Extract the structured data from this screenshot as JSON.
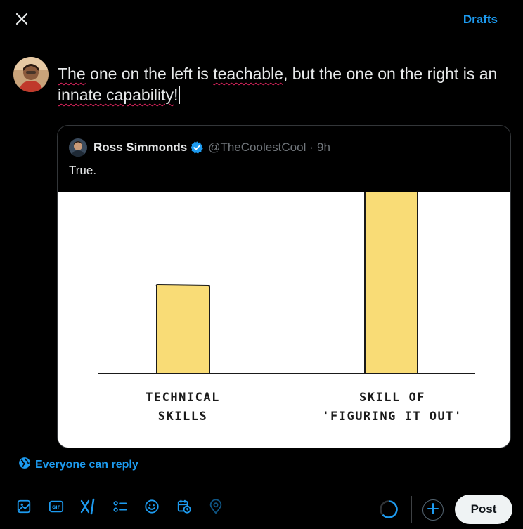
{
  "header": {
    "close_icon": "close-icon",
    "drafts_label": "Drafts"
  },
  "composer": {
    "text_parts": [
      "The",
      " one on the left is ",
      "teachable",
      ", but the one on the right is an ",
      "innate capability",
      "!"
    ]
  },
  "quote": {
    "author_name": "Ross Simmonds",
    "verified": true,
    "handle": "@TheCoolestCool",
    "separator": "·",
    "time": "9h",
    "text": "True.",
    "image": {
      "bar_labels": [
        [
          "TECHNICAL",
          "SKILLS"
        ],
        [
          "SKILL OF",
          "'FIGURING IT OUT'"
        ]
      ],
      "bar_color": "#f9dc76",
      "bar_heights_relative": [
        0.48,
        1.0
      ]
    }
  },
  "reply_setting": {
    "icon": "globe-icon",
    "label": "Everyone can reply"
  },
  "toolbar": {
    "tools": [
      "image-icon",
      "gif-icon",
      "grok-icon",
      "poll-icon",
      "emoji-icon",
      "schedule-icon",
      "location-icon"
    ]
  },
  "actions": {
    "post_label": "Post",
    "add_icon": "plus-icon"
  },
  "colors": {
    "accent": "#1d9bf0",
    "background": "#000000",
    "text": "#e7e9ea",
    "muted": "#71767b",
    "post_button_bg": "#eff3f4"
  }
}
